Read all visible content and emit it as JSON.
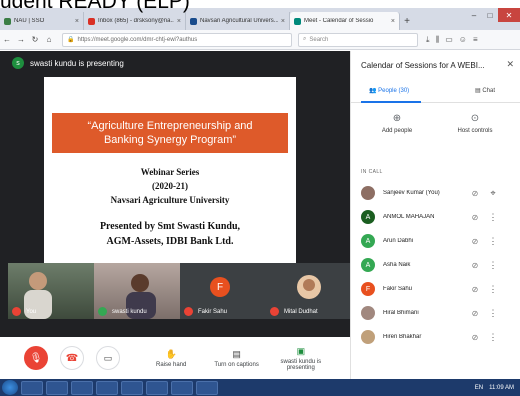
{
  "overlay": {
    "caption": "udent READY (ELP)"
  },
  "browser": {
    "tabs": [
      {
        "label": "NAU | SSO",
        "icon": "nau-favicon"
      },
      {
        "label": "Inbox (865) - drsksony@na...",
        "icon": "gmail-favicon"
      },
      {
        "label": "Navsari Agricultural Univers...",
        "icon": "nau-site-favicon"
      },
      {
        "label": "Meet - Calendar of Sessio",
        "icon": "meet-favicon",
        "active": true
      }
    ],
    "url": "https://meet.google.com/dmr-chtj-ewi?authus",
    "search_placeholder": "Search",
    "new_tab": "+",
    "close_tab": "×"
  },
  "meet": {
    "presenter_initial": "s",
    "presenting_text": "swasti kundu is presenting",
    "slide": {
      "banner_line1": "“Agriculture Entrepreneurship and",
      "banner_line2": "Banking Synergy Program”",
      "series": "Webinar Series",
      "years": "(2020-21)",
      "university": "Navsari Agriculture University",
      "presented_by": "Presented by Smt Swasti Kundu,",
      "designation": "AGM-Assets, IDBI Bank Ltd."
    },
    "tiles": [
      {
        "label": "You"
      },
      {
        "label": "swasti kundu"
      },
      {
        "label": "Fakir Sahu",
        "initial": "F"
      },
      {
        "label": "Mital Dudhat"
      }
    ],
    "controls": {
      "raise_hand": "Raise hand",
      "captions": "Turn on captions",
      "presenting": "swasti kundu is presenting"
    }
  },
  "side": {
    "title": "Calendar of Sessions for A WEBI...",
    "people_tab": "People (30)",
    "chat_tab": "Chat",
    "add_people": "Add people",
    "host_controls": "Host controls",
    "in_call_label": "IN CALL",
    "participants": [
      {
        "name": "Sanjeev Kumar (You)",
        "color": "#8d6e63",
        "initial": "",
        "action": "pin"
      },
      {
        "name": "ANMOL MAHAJAN",
        "color": "#1b5e20",
        "initial": "A",
        "action": "more"
      },
      {
        "name": "Arun Dabhi",
        "color": "#34a853",
        "initial": "A",
        "action": "more"
      },
      {
        "name": "Asha Naik",
        "color": "#34a853",
        "initial": "A",
        "action": "more"
      },
      {
        "name": "Fakir Sahu",
        "color": "#e8501f",
        "initial": "F",
        "action": "more"
      },
      {
        "name": "Hiral Bhimani",
        "color": "#a1887f",
        "initial": "",
        "action": "more"
      },
      {
        "name": "Hiren Bhakhar",
        "color": "#c0a07a",
        "initial": "",
        "action": "more"
      }
    ]
  },
  "taskbar": {
    "lang": "EN",
    "time": "11:09 AM"
  },
  "colors": {
    "meet_dark": "#202124",
    "accent": "#1a73e8",
    "end_call": "#ea4335",
    "slide_orange": "#de5a2a"
  }
}
